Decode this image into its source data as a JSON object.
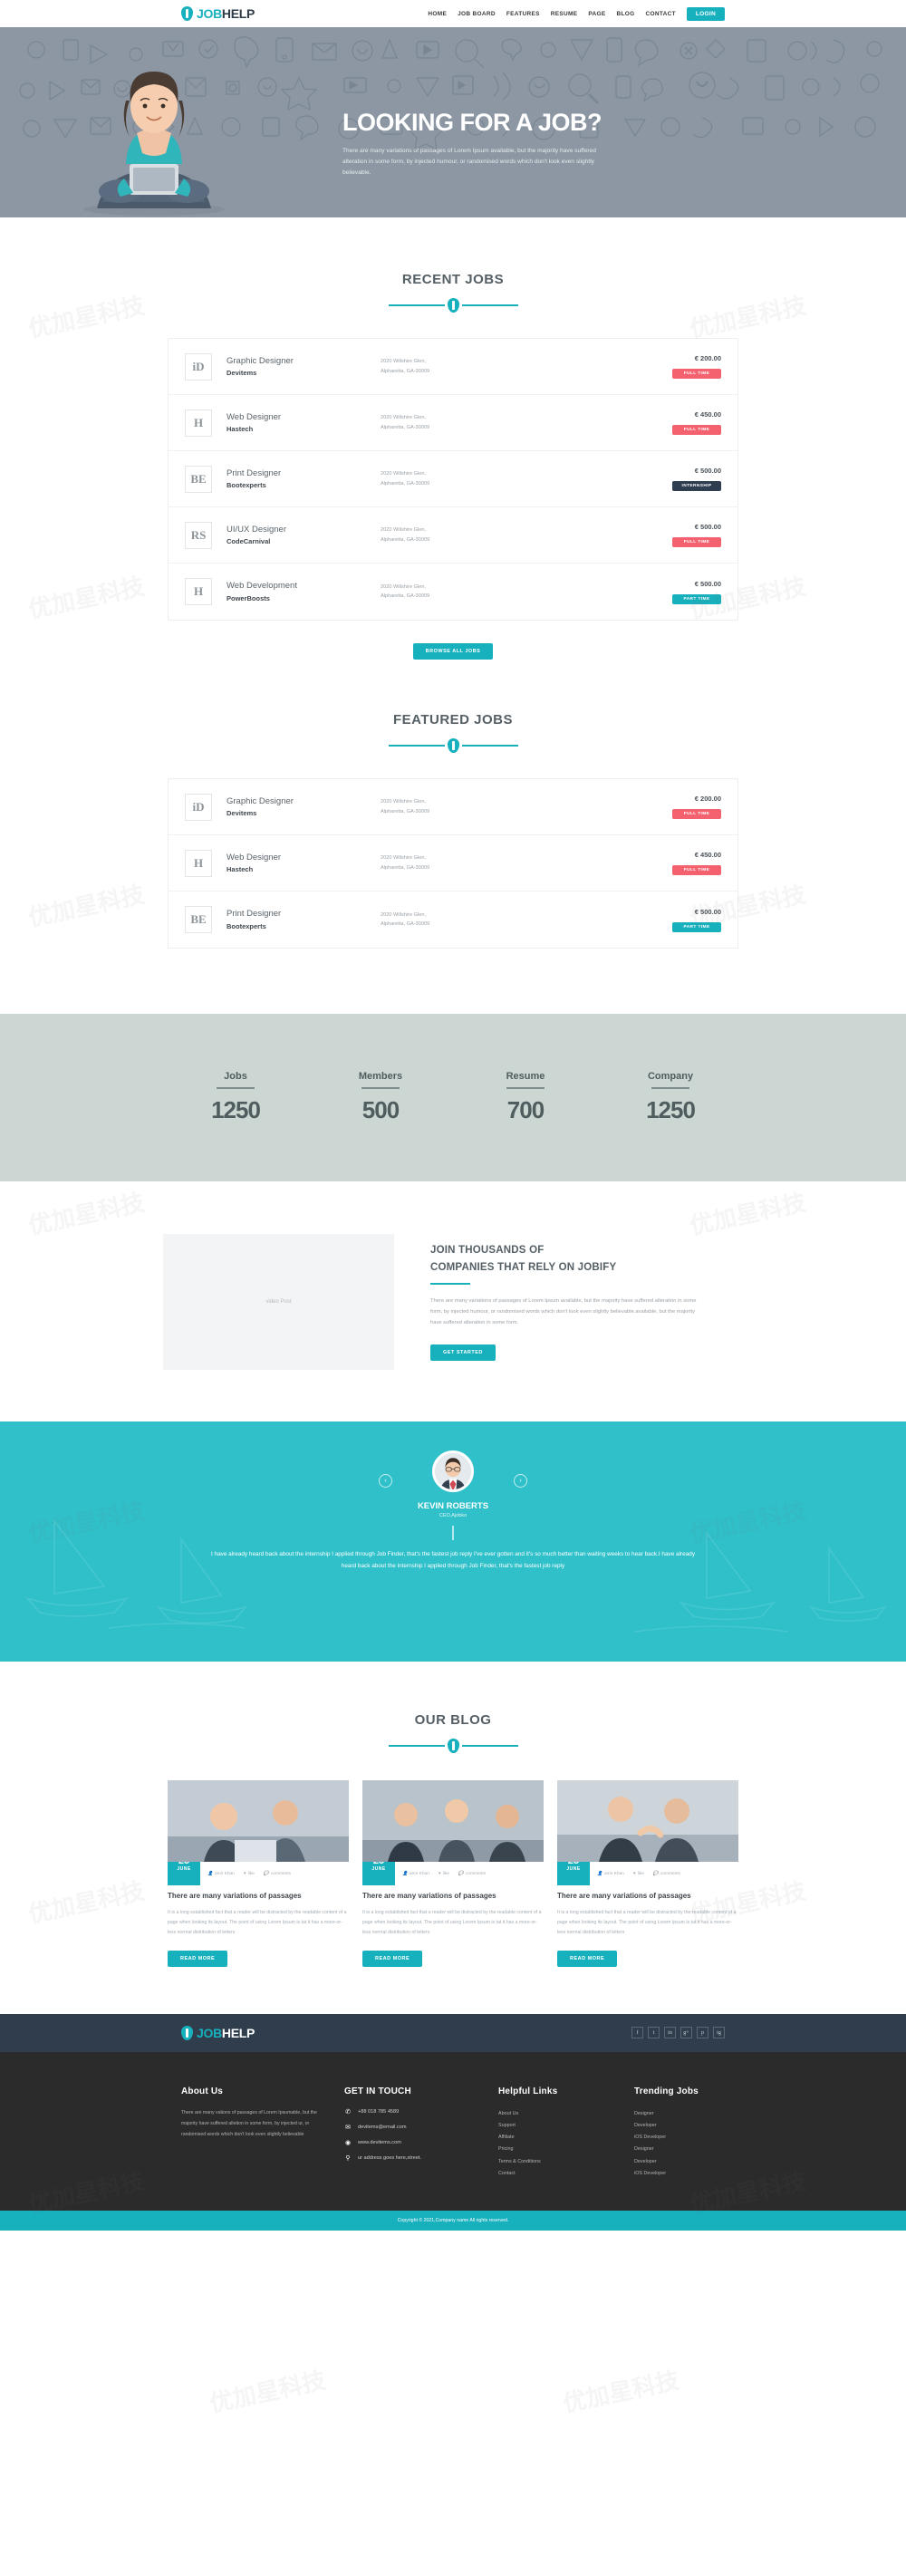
{
  "header": {
    "logo": {
      "part1": "JOB",
      "part2": "HELP",
      "icon": "tie-icon"
    },
    "nav": [
      {
        "label": "HOME"
      },
      {
        "label": "JOB BOARD"
      },
      {
        "label": "FEATURES"
      },
      {
        "label": "RESUME"
      },
      {
        "label": "PAGE"
      },
      {
        "label": "BLOG"
      },
      {
        "label": "CONTACT"
      }
    ],
    "login_label": "LOGIN"
  },
  "hero": {
    "heading": "LOOKING FOR A JOB?",
    "paragraph": "There are many variations of passages of Lorem Ipsum available, but the majority have suffered alteration in some form, by injected humour, or randomised words which don't look even slightly believable."
  },
  "recent_jobs": {
    "title": "RECENT JOBS",
    "browse_label": "BROWSE ALL JOBS",
    "rows": [
      {
        "thumb": "iD",
        "title": "Graphic Designer",
        "company": "Devitems",
        "address_line1": "2020 Willshire Glen,",
        "address_line2": "Alpharetta, GA-30009",
        "price": "€ 200.00",
        "badge": "FULL TIME",
        "badge_type": "full"
      },
      {
        "thumb": "H",
        "title": "Web Designer",
        "company": "Hastech",
        "address_line1": "2020 Willshire Glen,",
        "address_line2": "Alpharetta, GA-30009",
        "price": "€ 450.00",
        "badge": "FULL TIME",
        "badge_type": "full"
      },
      {
        "thumb": "BE",
        "title": "Print Designer",
        "company": "Bootexperts",
        "address_line1": "2020 Willshire Glen,",
        "address_line2": "Alpharetta, GA-30009",
        "price": "€ 500.00",
        "badge": "INTERNSHIP",
        "badge_type": "intern"
      },
      {
        "thumb": "RS",
        "title": "UI/UX Designer",
        "company": "CodeCarnival",
        "address_line1": "2020 Willshire Glen,",
        "address_line2": "Alpharetta, GA-30009",
        "price": "€ 500.00",
        "badge": "FULL TIME",
        "badge_type": "full"
      },
      {
        "thumb": "H",
        "title": "Web Development",
        "company": "PowerBoosts",
        "address_line1": "2020 Willshire Glen,",
        "address_line2": "Alpharetta, GA-30009",
        "price": "€ 500.00",
        "badge": "PART TIME",
        "badge_type": "part"
      }
    ]
  },
  "featured_jobs": {
    "title": "FEATURED JOBS",
    "rows": [
      {
        "thumb": "iD",
        "title": "Graphic Designer",
        "company": "Devitems",
        "address_line1": "2020 Willshire Glen,",
        "address_line2": "Alpharetta, GA-30009",
        "price": "€ 200.00",
        "badge": "FULL TIME",
        "badge_type": "full"
      },
      {
        "thumb": "H",
        "title": "Web Designer",
        "company": "Hastech",
        "address_line1": "2020 Willshire Glen,",
        "address_line2": "Alpharetta, GA-30009",
        "price": "€ 450.00",
        "badge": "FULL TIME",
        "badge_type": "full"
      },
      {
        "thumb": "BE",
        "title": "Print Designer",
        "company": "Bootexperts",
        "address_line1": "2020 Willshire Glen,",
        "address_line2": "Alpharetta, GA-30009",
        "price": "€ 500.00",
        "badge": "PART TIME",
        "badge_type": "part"
      }
    ]
  },
  "counters": [
    {
      "label": "Jobs",
      "value": "1250"
    },
    {
      "label": "Members",
      "value": "500"
    },
    {
      "label": "Resume",
      "value": "700"
    },
    {
      "label": "Company",
      "value": "1250"
    }
  ],
  "join": {
    "video_placeholder": "video Post",
    "heading_line1": "JOIN THOUSANDS OF",
    "heading_line2": "COMPANIES THAT RELY ON JOBIFY",
    "paragraph": "There are many variations of passages of Lorem Ipsum available, but the majority have suffered alteration in some form, by injected humour, or randomised words which don't look even slightly believable.available, but the majority have suffered alteration in some form.",
    "button_label": "GET STARTED"
  },
  "testimonial": {
    "name": "KEVIN ROBERTS",
    "role": "CEO,Ajobko",
    "quote": "I have already heard back about the internship I applied through Job Finder, that's the fastest job reply I've ever gotten and it's so much better than waiting weeks to hear back.I have already heard back about the internship I applied through Job Finder, that's the fastest job reply",
    "prev_icon": "chevron-left-icon",
    "next_icon": "chevron-right-icon"
  },
  "blog": {
    "title": "OUR BLOG",
    "posts": [
      {
        "day": "25",
        "month": "JUNE",
        "author": "amir Khan",
        "likes": "like",
        "comments": "comments",
        "title": "There are many variations of passages",
        "excerpt": "It is a long established fact that a reader will be distracted by the readable content of a page when looking its layout. The point of using Lorem Ipsum is tat it has a more-or-less normal distribution of letters",
        "button_label": "READ MORE"
      },
      {
        "day": "25",
        "month": "JUNE",
        "author": "amir Khan",
        "likes": "like",
        "comments": "comments",
        "title": "There are many variations of passages",
        "excerpt": "It is a long established fact that a reader will be distracted by the readable content of a page when looking its layout. The point of using Lorem Ipsum is tat it has a more-or-less normal distribution of letters",
        "button_label": "READ MORE"
      },
      {
        "day": "25",
        "month": "JUNE",
        "author": "amir Khan",
        "likes": "like",
        "comments": "comments",
        "title": "There are many variations of passages",
        "excerpt": "It is a long established fact that a reader will be distracted by the readable content of a page when looking its layout. The point of using Lorem Ipsum is tat it has a more-or-less normal distribution of letters",
        "button_label": "READ MORE"
      }
    ]
  },
  "footer": {
    "logo": {
      "part1": "JOB",
      "part2": "HELP"
    },
    "socials": [
      {
        "name": "facebook-icon",
        "glyph": "f"
      },
      {
        "name": "twitter-icon",
        "glyph": "t"
      },
      {
        "name": "linkedin-icon",
        "glyph": "in"
      },
      {
        "name": "google-plus-icon",
        "glyph": "g+"
      },
      {
        "name": "pinterest-icon",
        "glyph": "p"
      },
      {
        "name": "instagram-icon",
        "glyph": "ig"
      }
    ],
    "about": {
      "heading": "About Us",
      "text": "There are many vations of passages of Lorem Ipsumable, but the majority have suffered alletion in some form, by injected ur, or randomised words which don't look even slightly believable"
    },
    "contact": {
      "heading": "GET IN TOUCH",
      "items": [
        {
          "icon": "phone-icon",
          "glyph": "✆",
          "text": "+88 018 785 4589"
        },
        {
          "icon": "envelope-icon",
          "glyph": "✉",
          "text": "devitems@email.com"
        },
        {
          "icon": "globe-icon",
          "glyph": "◉",
          "text": "www.devitems.com"
        },
        {
          "icon": "map-pin-icon",
          "glyph": "⚲",
          "text": "ur address goes here,street."
        }
      ]
    },
    "helpful": {
      "heading": "Helpful Links",
      "links": [
        "About Us",
        "Support",
        "Affiliate",
        "Pricing",
        "Terms & Conditions",
        "Contact"
      ]
    },
    "trending": {
      "heading": "Trending Jobs",
      "links": [
        "Designer",
        "Developer",
        "iOS Developer",
        "Designer",
        "Developer",
        "iOS Developer"
      ]
    },
    "copyright": "Copyright © 2021,Company name All rights reserved."
  },
  "colors": {
    "accent": "#17b0bd",
    "accent_light": "#2fc0ca",
    "danger": "#f4626f",
    "navy": "#2e3e50",
    "dark": "#2b2b2b"
  }
}
